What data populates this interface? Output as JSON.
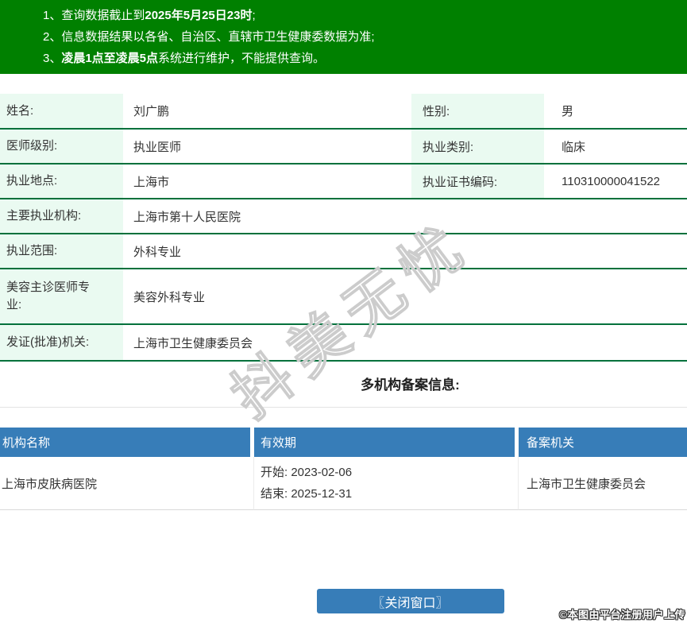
{
  "banner": {
    "bg_color": "#008000",
    "lines": [
      {
        "num": "1、",
        "pre": "查询数据截止到",
        "bold": "2025年5月25日23时",
        "post": ";"
      },
      {
        "num": "2、",
        "pre": "信息数据结果以各省、自治区、直辖市卫生健康委数据为准;",
        "bold": "",
        "post": ""
      },
      {
        "num": "3、",
        "pre": "",
        "bold": "凌晨1点至凌晨5点",
        "post": "系统进行维护，不能提供查询。"
      }
    ]
  },
  "info": {
    "rows": [
      {
        "label1": "姓名:",
        "value1": "刘广鹏",
        "label2": "性别:",
        "value2": "男"
      },
      {
        "label1": "医师级别:",
        "value1": "执业医师",
        "label2": "执业类别:",
        "value2": "临床"
      },
      {
        "label1": "执业地点:",
        "value1": "上海市",
        "label2": "执业证书编码:",
        "value2": "110310000041522"
      },
      {
        "label1": "主要执业机构:",
        "value1": "上海市第十人民医院"
      },
      {
        "label1": "执业范围:",
        "value1": "外科专业"
      },
      {
        "label1": "美容主诊医师专业:",
        "value1": "美容外科专业"
      },
      {
        "label1": "发证(批准)机关:",
        "value1": "上海市卫生健康委员会"
      }
    ]
  },
  "filing": {
    "title": "多机构备案信息:",
    "headers": [
      "机构名称",
      "有效期",
      "备案机关"
    ],
    "header_color": "#377db8",
    "rows": [
      {
        "org": "上海市皮肤病医院",
        "start": "开始: 2023-02-06",
        "end": "结束: 2025-12-31",
        "authority": "上海市卫生健康委员会"
      }
    ]
  },
  "button": {
    "close_label": "〖关闭窗口〗",
    "color": "#377db8"
  },
  "watermark": {
    "diagonal": "抖美无忧",
    "copyright": "©本图由平台注册用户上传"
  },
  "colors": {
    "banner_green": "#008000",
    "label_cell_bg": "#eafaf1",
    "row_border_green": "#00713c",
    "table_header_blue": "#377db8"
  }
}
